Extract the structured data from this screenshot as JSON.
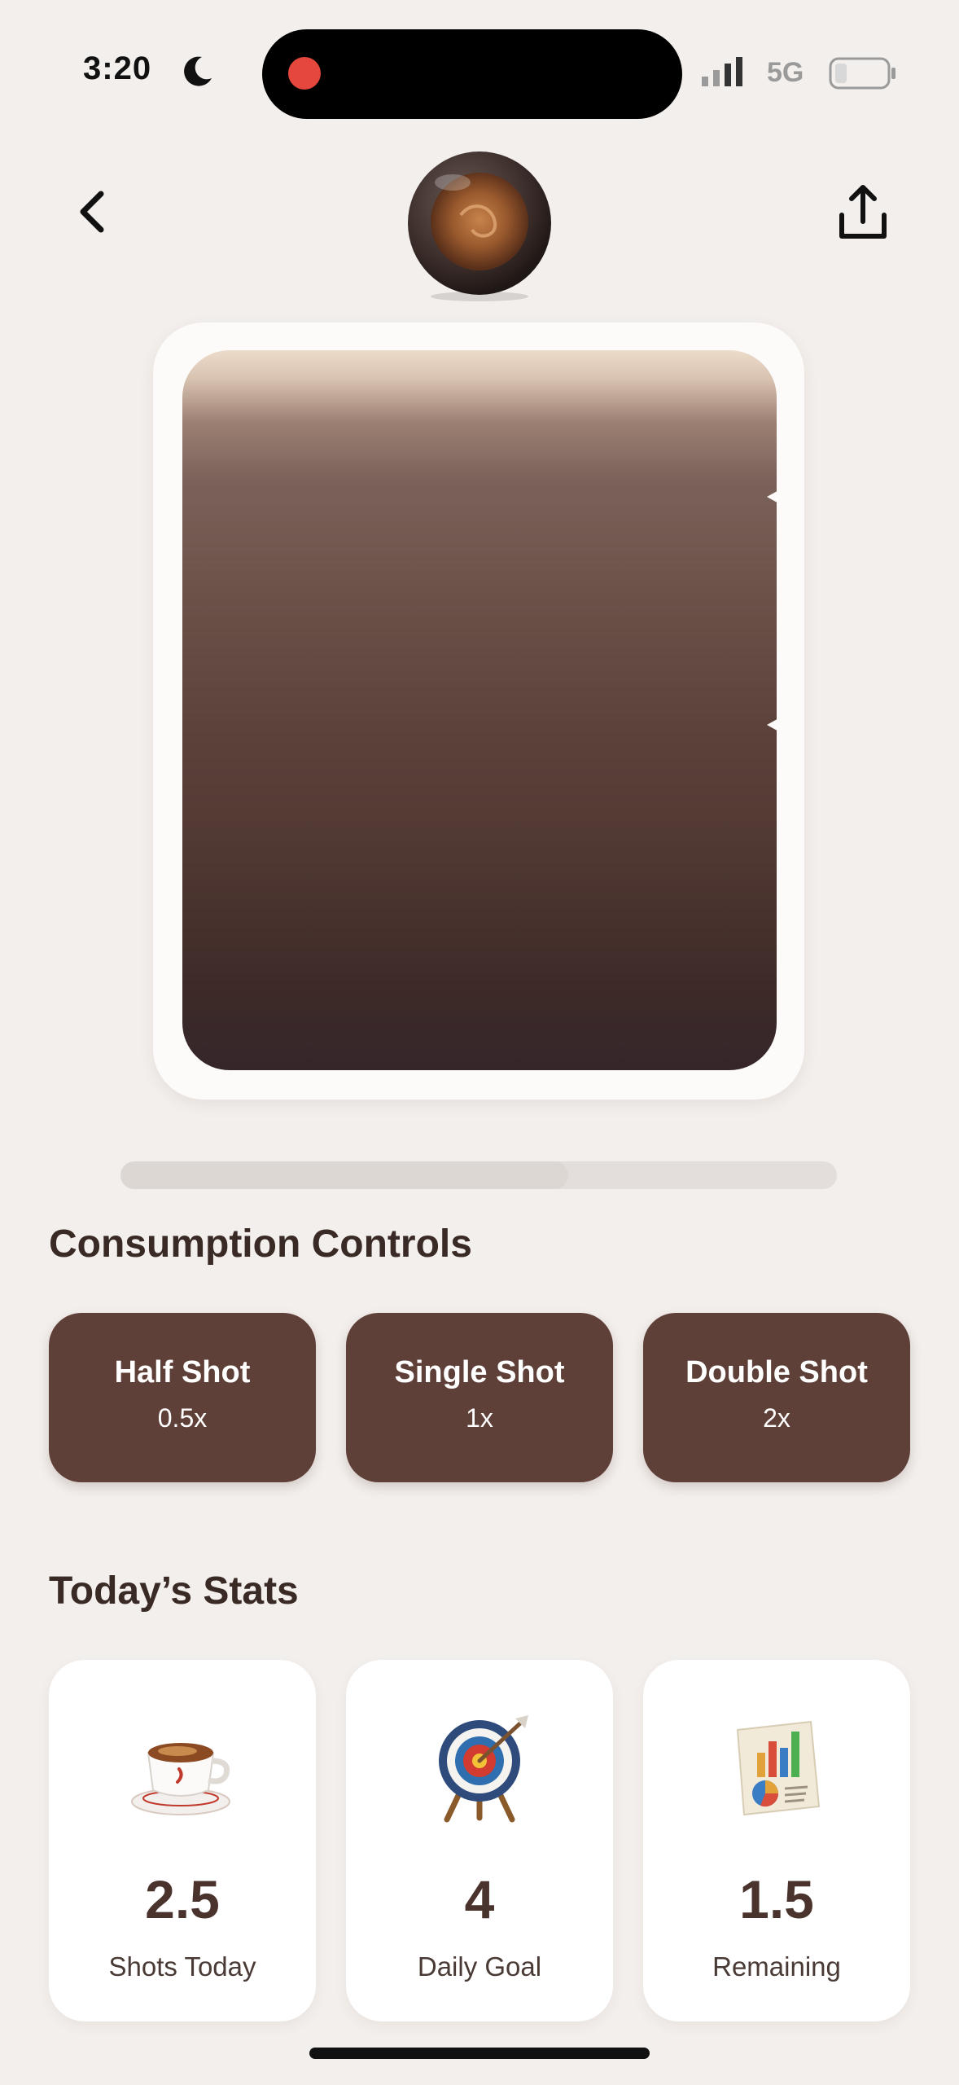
{
  "status_bar": {
    "time": "3:20",
    "network": "5G",
    "icons": [
      "moon-icon",
      "signal-icon",
      "battery-icon"
    ]
  },
  "header": {
    "back_icon": "chevron-left-icon",
    "share_icon": "share-icon",
    "logo_icon": "espresso-cup-icon"
  },
  "coffee_level": {
    "progress_fraction": 0.625
  },
  "consumption": {
    "title": "Consumption Controls",
    "buttons": [
      {
        "label": "Half Shot",
        "multiplier": "0.5x"
      },
      {
        "label": "Single Shot",
        "multiplier": "1x"
      },
      {
        "label": "Double Shot",
        "multiplier": "2x"
      }
    ]
  },
  "stats": {
    "title": "Today’s Stats",
    "cards": [
      {
        "value": "2.5",
        "label": "Shots Today",
        "icon": "coffee-cup-icon"
      },
      {
        "value": "4",
        "label": "Daily Goal",
        "icon": "target-icon"
      },
      {
        "value": "1.5",
        "label": "Remaining",
        "icon": "report-chart-icon"
      }
    ]
  },
  "colors": {
    "background": "#f3efec",
    "button": "#5f4038",
    "coffee_dark": "#35262a",
    "accent_red": "#e5473c"
  }
}
